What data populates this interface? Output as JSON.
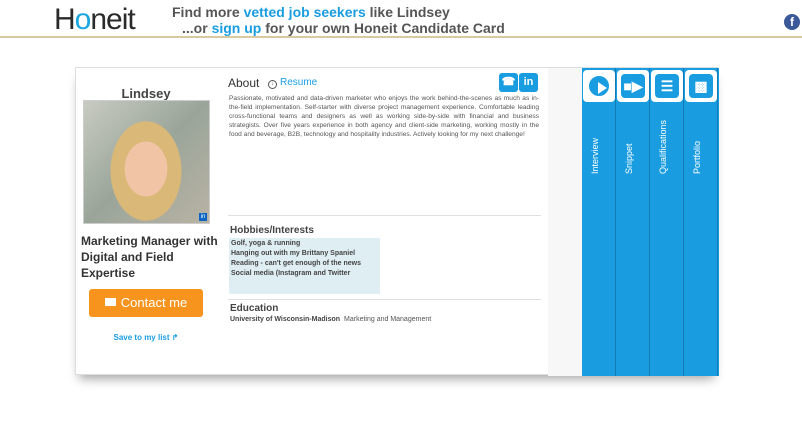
{
  "header": {
    "logo_text_1": "H",
    "logo_text_accent": "o",
    "logo_text_2": "neit",
    "line1_prefix": "Find more ",
    "line1_link": "vetted job seekers",
    "line1_suffix": " like Lindsey",
    "line2_prefix": "...or ",
    "line2_link": "sign up",
    "line2_suffix": " for your own Honeit Candidate Card",
    "fb_icon": "f"
  },
  "profile": {
    "name": "Lindsey",
    "title": "Marketing Manager with Digital and Field Expertise",
    "contact_label": "Contact me",
    "save_label": "Save to my list ↱"
  },
  "about": {
    "heading": "About",
    "resume_link": "Resume",
    "text": "Passionate, motivated and data-driven marketer who enjoys the work behind-the-scenes as much as in-the-field implementation. Self-starter with diverse project management experience. Comfortable leading cross-functional teams and designers as well as working side-by-side with financial and business strategists. Over five years experience in both agency and client-side marketing, working mostly in the food and beverage, B2B, technology and hospitality industries. Actively looking for my next challenge!",
    "phone_icon": "☎",
    "linkedin_icon": "in"
  },
  "hobbies": {
    "heading": "Hobbies/Interests",
    "items": [
      "Golf, yoga & running",
      "Hanging out with my Brittany Spaniel",
      "Reading - can't get enough of the news",
      "Social media (Instagram and Twitter"
    ]
  },
  "education": {
    "heading": "Education",
    "school": "University of Wisconsin-Madison",
    "field": "Marketing and Management"
  },
  "tabs": [
    {
      "label": "Interview",
      "icon": "play-icon"
    },
    {
      "label": "Snippet",
      "icon": "video-camera-icon"
    },
    {
      "label": "Qualifications",
      "icon": "list-icon"
    },
    {
      "label": "Portfolio",
      "icon": "briefcase-icon"
    }
  ],
  "colors": {
    "accent": "#1a9de0",
    "contact_button": "#f7941d",
    "hobbies_bg": "#dfeef3"
  }
}
